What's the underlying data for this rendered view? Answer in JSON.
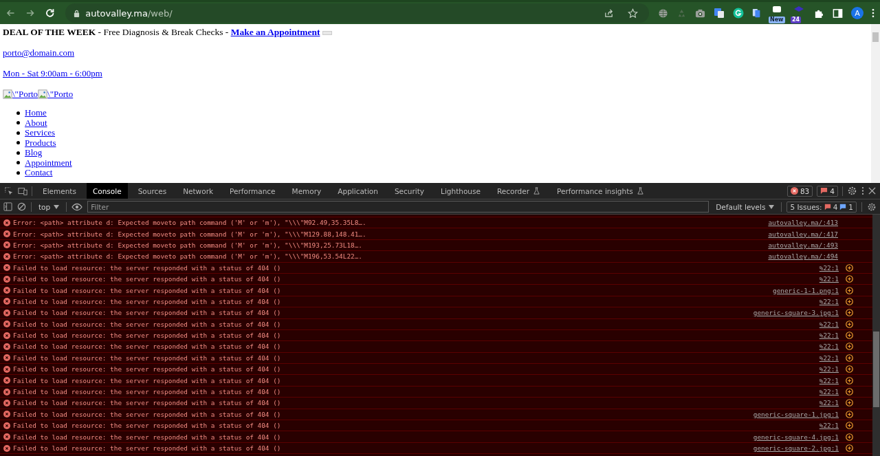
{
  "browser": {
    "url_host": "autovalley.ma",
    "url_path": "/web/",
    "extension_badges": [
      {
        "kind": "new",
        "text": "New"
      },
      {
        "kind": "count",
        "text": "24"
      }
    ],
    "profile_initial": "A"
  },
  "page": {
    "deal_heading": "DEAL OF THE WEEK",
    "deal_text": " - Free Diagnosis & Break Checks - ",
    "deal_link": "Make an Appointment",
    "email": "porto@domain.com",
    "hours": "Mon - Sat 9:00am - 6:00pm",
    "logo_alts": [
      "\\\"Porto",
      "\\\"Porto"
    ],
    "nav": [
      "Home",
      "About",
      "Services",
      "Products",
      "Blog",
      "Appointment",
      "Contact"
    ]
  },
  "devtools": {
    "tabs": [
      {
        "label": "Elements",
        "selected": false,
        "experimental": false
      },
      {
        "label": "Console",
        "selected": true,
        "experimental": false
      },
      {
        "label": "Sources",
        "selected": false,
        "experimental": false
      },
      {
        "label": "Network",
        "selected": false,
        "experimental": false
      },
      {
        "label": "Performance",
        "selected": false,
        "experimental": false
      },
      {
        "label": "Memory",
        "selected": false,
        "experimental": false
      },
      {
        "label": "Application",
        "selected": false,
        "experimental": false
      },
      {
        "label": "Security",
        "selected": false,
        "experimental": false
      },
      {
        "label": "Lighthouse",
        "selected": false,
        "experimental": false
      },
      {
        "label": "Recorder",
        "selected": false,
        "experimental": true
      },
      {
        "label": "Performance insights",
        "selected": false,
        "experimental": true
      }
    ],
    "error_count": "83",
    "issue_count": "4",
    "context": "top",
    "filter": {
      "placeholder": "Filter"
    },
    "levels": "Default levels",
    "issues_label": "5 Issues:",
    "issues_errors": "4",
    "issues_info": "1",
    "messages": [
      {
        "kind": "error",
        "text": "Error: <path> attribute d: Expected moveto path command ('M' or 'm'), \"\\\\\\\"M92.49,35.35L8….",
        "source": "autovalley.ma/:413"
      },
      {
        "kind": "error",
        "text": "Error: <path> attribute d: Expected moveto path command ('M' or 'm'), \"\\\\\\\"M129.88,148.41….",
        "source": "autovalley.ma/:417"
      },
      {
        "kind": "error",
        "text": "Error: <path> attribute d: Expected moveto path command ('M' or 'm'), \"\\\\\\\"M193,25.73L18….",
        "source": "autovalley.ma/:493"
      },
      {
        "kind": "error",
        "text": "Error: <path> attribute d: Expected moveto path command ('M' or 'm'), \"\\\\\\\"M196,53.54L22….",
        "source": "autovalley.ma/:494"
      },
      {
        "kind": "network",
        "text": "Failed to load resource: the server responded with a status of 404 ()",
        "source": "%22:1"
      },
      {
        "kind": "network",
        "text": "Failed to load resource: the server responded with a status of 404 ()",
        "source": "%22:1"
      },
      {
        "kind": "network",
        "text": "Failed to load resource: the server responded with a status of 404 ()",
        "source": "generic-1-1.png:1"
      },
      {
        "kind": "network",
        "text": "Failed to load resource: the server responded with a status of 404 ()",
        "source": "%22:1"
      },
      {
        "kind": "network",
        "text": "Failed to load resource: the server responded with a status of 404 ()",
        "source": "generic-square-3.jpg:1"
      },
      {
        "kind": "network",
        "text": "Failed to load resource: the server responded with a status of 404 ()",
        "source": "%22:1"
      },
      {
        "kind": "network",
        "text": "Failed to load resource: the server responded with a status of 404 ()",
        "source": "%22:1"
      },
      {
        "kind": "network",
        "text": "Failed to load resource: the server responded with a status of 404 ()",
        "source": "%22:1"
      },
      {
        "kind": "network",
        "text": "Failed to load resource: the server responded with a status of 404 ()",
        "source": "%22:1"
      },
      {
        "kind": "network",
        "text": "Failed to load resource: the server responded with a status of 404 ()",
        "source": "%22:1"
      },
      {
        "kind": "network",
        "text": "Failed to load resource: the server responded with a status of 404 ()",
        "source": "%22:1"
      },
      {
        "kind": "network",
        "text": "Failed to load resource: the server responded with a status of 404 ()",
        "source": "%22:1"
      },
      {
        "kind": "network",
        "text": "Failed to load resource: the server responded with a status of 404 ()",
        "source": "%22:1"
      },
      {
        "kind": "network",
        "text": "Failed to load resource: the server responded with a status of 404 ()",
        "source": "generic-square-1.jpg:1"
      },
      {
        "kind": "network",
        "text": "Failed to load resource: the server responded with a status of 404 ()",
        "source": "%22:1"
      },
      {
        "kind": "network",
        "text": "Failed to load resource: the server responded with a status of 404 ()",
        "source": "generic-square-4.jpg:1"
      },
      {
        "kind": "network",
        "text": "Failed to load resource: the server responded with a status of 404 ()",
        "source": "generic-square-2.jpg:1"
      }
    ]
  }
}
